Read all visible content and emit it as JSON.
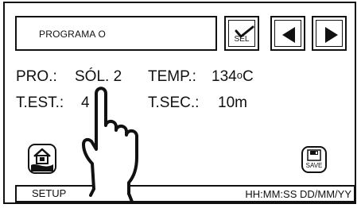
{
  "header": {
    "program_label": "PROGRAMA O",
    "sel_label": "SEL",
    "prev_icon": "triangle-left-icon",
    "next_icon": "triangle-right-icon",
    "check_icon": "checkmark-icon"
  },
  "status": {
    "pro_label": "PRO.:",
    "pro_value": "SÓL. 2",
    "temp_label": "TEMP.:",
    "temp_value": "134",
    "temp_unit_deg": "o",
    "temp_unit": "C",
    "test_label": "T.EST.:",
    "test_value": "4",
    "tsec_label": "T.SEC.:",
    "tsec_value": "10m"
  },
  "footer": {
    "setup_label": "SETUP",
    "clock_label": "HH:MM:SS DD/MM/YY",
    "setup_icon": "house-setup-icon",
    "save_label": "SAVE",
    "save_icon": "floppy-disk-icon"
  },
  "overlay": {
    "hand_icon": "pointing-hand-icon"
  }
}
